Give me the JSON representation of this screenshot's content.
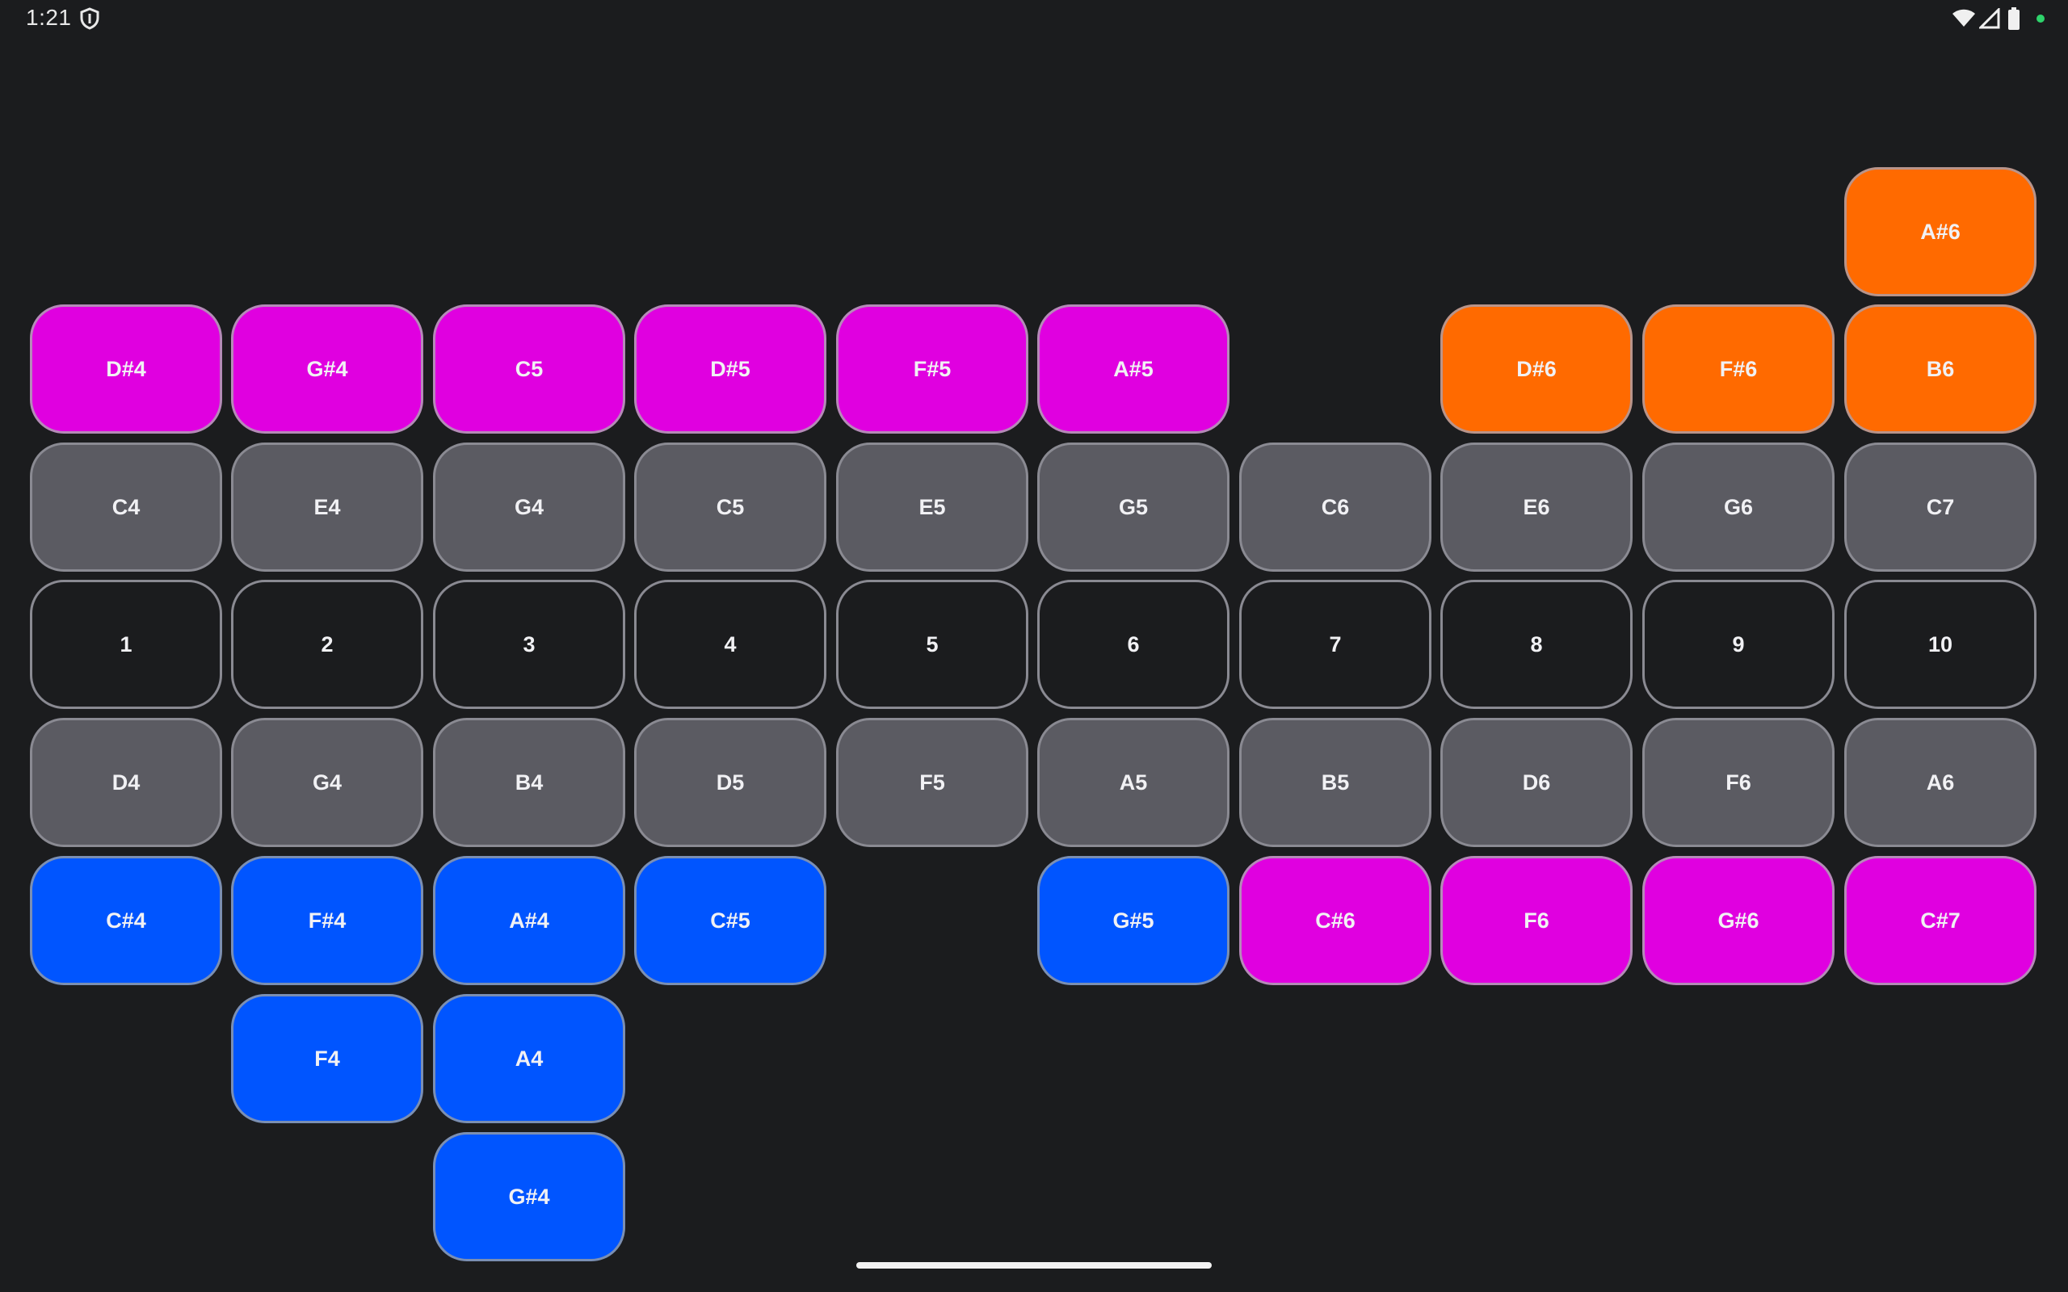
{
  "status_bar": {
    "time": "1:21",
    "icons": [
      "vpn-shield-icon",
      "wifi-icon",
      "cell-signal-icon",
      "battery-icon",
      "privacy-dot-icon"
    ]
  },
  "colors": {
    "background": "#1b1c1e",
    "magenta": "#e000e0",
    "orange": "#ff6a00",
    "gray": "#5b5b62",
    "blue": "#0055ff"
  },
  "pads": {
    "row0": [
      "A#6"
    ],
    "row1": [
      "D#4",
      "G#4",
      "C5",
      "D#5",
      "F#5",
      "A#5",
      "D#6",
      "F#6",
      "B6"
    ],
    "row2": [
      "C4",
      "E4",
      "G4",
      "C5",
      "E5",
      "G5",
      "C6",
      "E6",
      "G6",
      "C7"
    ],
    "row3": [
      "1",
      "2",
      "3",
      "4",
      "5",
      "6",
      "7",
      "8",
      "9",
      "10"
    ],
    "row4": [
      "D4",
      "G4",
      "B4",
      "D5",
      "F5",
      "A5",
      "B5",
      "D6",
      "F6",
      "A6"
    ],
    "row5": [
      "C#4",
      "F#4",
      "A#4",
      "C#5",
      "G#5",
      "C#6",
      "F6",
      "G#6",
      "C#7"
    ],
    "row6": [
      "F4",
      "A4"
    ],
    "row7": [
      "G#4"
    ]
  }
}
